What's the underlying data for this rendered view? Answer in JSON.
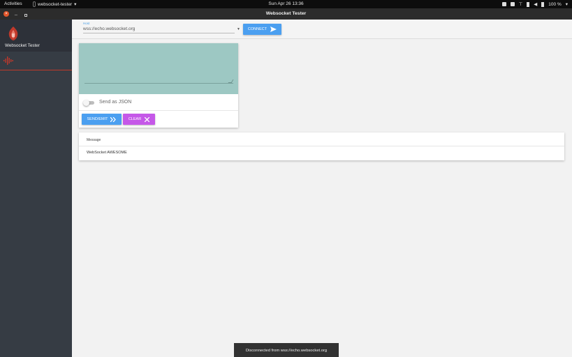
{
  "system_bar": {
    "activities": "Activities",
    "app_menu": "websocket-tester",
    "clock": "Sun Apr 26  13:36",
    "battery": "100 %"
  },
  "window": {
    "title": "Websocket Tester"
  },
  "sidebar": {
    "app_name": "Websocket Tester",
    "items": [
      {
        "icon": "waveform-icon",
        "active": true
      }
    ]
  },
  "connection": {
    "host_label": "Host",
    "host_value": "wss://echo.websocket.org",
    "connect_label": "CONNECT"
  },
  "composer": {
    "message_value": "",
    "json_toggle_label": "Send as JSON",
    "json_toggle_on": false,
    "send_label": "SEND/EMIT",
    "clear_label": "CLEAR"
  },
  "log": {
    "header": "Message",
    "rows": [
      "WebSocket AWESOME"
    ]
  },
  "snackbar": "Disconnected from wss://echo.websocket.org",
  "colors": {
    "primary": "#4b9ff0",
    "accent": "#c558e8",
    "brand": "#e2562b",
    "message_area": "#9dc8c3",
    "sidebar": "#363c44"
  }
}
